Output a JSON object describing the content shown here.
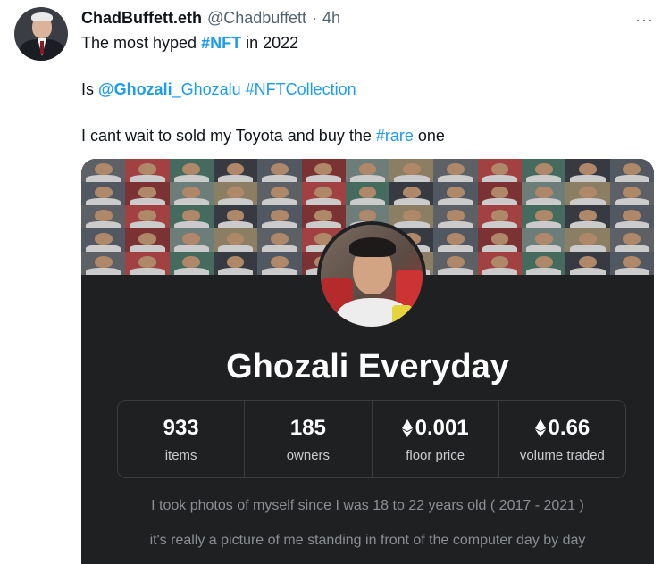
{
  "tweet": {
    "author_name": "ChadBuffett.eth",
    "author_handle": "@Chadbuffett",
    "separator": "·",
    "time": "4h",
    "more_icon": "···",
    "line1": {
      "before": "The most hyped ",
      "hashtag": "#NFT",
      "after": " in 2022"
    },
    "line2": {
      "before": "Is ",
      "mention": "@Ghozali",
      "link_rest": "_Ghozalu",
      "space": " ",
      "hashtag": "#NFTCollection"
    },
    "line3": {
      "before": "I cant wait to sold my Toyota and buy the ",
      "hashtag": "#rare",
      "after": " one"
    }
  },
  "media": {
    "collection_name": "Ghozali Everyday",
    "stats": [
      {
        "value": "933",
        "label": "items",
        "eth": false
      },
      {
        "value": "185",
        "label": "owners",
        "eth": false
      },
      {
        "value": "0.001",
        "label": "floor price",
        "eth": true
      },
      {
        "value": "0.66",
        "label": "volume traded",
        "eth": true
      }
    ],
    "description_line1": "I took photos of myself since I was 18 to 22 years old ( 2017 - 2021 )",
    "description_line2": "it's really a picture of me standing in front of the computer day by day"
  },
  "colors": {
    "link": "#1d9bf0",
    "card_bg": "#1f2022",
    "muted": "#536471"
  },
  "icons": {
    "more": "more-horizontal-icon",
    "eth": "ethereum-icon"
  }
}
